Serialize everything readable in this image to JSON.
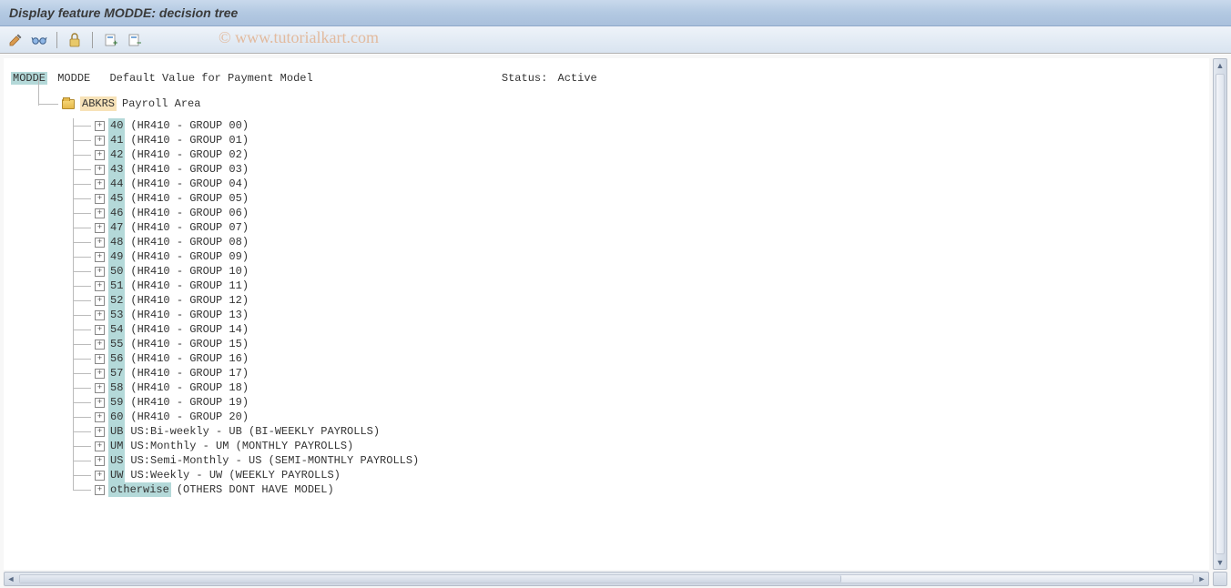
{
  "title": "Display feature MODDE: decision tree",
  "watermark": "© www.tutorialkart.com",
  "toolbar": {
    "icons": [
      "edit",
      "glasses",
      "lock",
      "doc-plus",
      "doc-check"
    ]
  },
  "root": {
    "code": "MODDE",
    "name": "MODDE",
    "desc": "Default Value for Payment Model",
    "status_label": "Status:",
    "status_value": "Active"
  },
  "level1": {
    "code": "ABKRS",
    "desc": "Payroll Area"
  },
  "leaves": [
    {
      "code": "40",
      "desc": "(HR410 - GROUP 00)"
    },
    {
      "code": "41",
      "desc": "(HR410 - GROUP 01)"
    },
    {
      "code": "42",
      "desc": "(HR410 - GROUP 02)"
    },
    {
      "code": "43",
      "desc": "(HR410 - GROUP 03)"
    },
    {
      "code": "44",
      "desc": "(HR410 - GROUP 04)"
    },
    {
      "code": "45",
      "desc": "(HR410 - GROUP 05)"
    },
    {
      "code": "46",
      "desc": "(HR410 - GROUP 06)"
    },
    {
      "code": "47",
      "desc": "(HR410 - GROUP 07)"
    },
    {
      "code": "48",
      "desc": "(HR410 - GROUP 08)"
    },
    {
      "code": "49",
      "desc": "(HR410 - GROUP 09)"
    },
    {
      "code": "50",
      "desc": "(HR410 - GROUP 10)"
    },
    {
      "code": "51",
      "desc": "(HR410 - GROUP 11)"
    },
    {
      "code": "52",
      "desc": "(HR410 - GROUP 12)"
    },
    {
      "code": "53",
      "desc": "(HR410 - GROUP 13)"
    },
    {
      "code": "54",
      "desc": "(HR410 - GROUP 14)"
    },
    {
      "code": "55",
      "desc": "(HR410 - GROUP 15)"
    },
    {
      "code": "56",
      "desc": "(HR410 - GROUP 16)"
    },
    {
      "code": "57",
      "desc": "(HR410 - GROUP 17)"
    },
    {
      "code": "58",
      "desc": "(HR410 - GROUP 18)"
    },
    {
      "code": "59",
      "desc": "(HR410 - GROUP 19)"
    },
    {
      "code": "60",
      "desc": "(HR410 - GROUP 20)"
    },
    {
      "code": "UB",
      "desc": "US:Bi-weekly - UB (BI-WEEKLY PAYROLLS)"
    },
    {
      "code": "UM",
      "desc": "US:Monthly - UM (MONTHLY PAYROLLS)"
    },
    {
      "code": "US",
      "desc": "US:Semi-Monthly - US (SEMI-MONTHLY PAYROLLS)"
    },
    {
      "code": "UW",
      "desc": "US:Weekly - UW (WEEKLY PAYROLLS)"
    },
    {
      "code": "otherwise",
      "desc": "(OTHERS DONT HAVE MODEL)"
    }
  ]
}
